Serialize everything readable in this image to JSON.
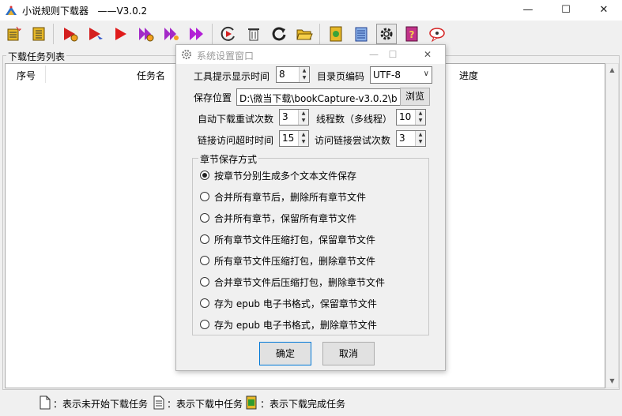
{
  "app": {
    "title": "小说规则下载器   ——V3.0.2",
    "window_controls": {
      "minimize": "—",
      "maximize": "☐",
      "close": "✕"
    }
  },
  "toolbar": {
    "buttons": [
      {
        "name": "new-task-icon"
      },
      {
        "name": "task-list-icon"
      },
      {
        "name": "start-settings-icon"
      },
      {
        "name": "start-select-icon"
      },
      {
        "name": "start-icon"
      },
      {
        "name": "start-all-settings-icon"
      },
      {
        "name": "fast-forward-settings-icon"
      },
      {
        "name": "fast-forward-icon"
      },
      {
        "name": "restart-icon"
      },
      {
        "name": "delete-icon"
      },
      {
        "name": "refresh-icon"
      },
      {
        "name": "open-folder-icon"
      },
      {
        "name": "book-icon"
      },
      {
        "name": "notebook-icon"
      },
      {
        "name": "gear-icon"
      },
      {
        "name": "help-book-icon"
      },
      {
        "name": "chat-icon"
      }
    ]
  },
  "task_panel": {
    "group_label": "下载任务列表",
    "columns": [
      "序号",
      "任务名",
      "进度"
    ]
  },
  "status_bar": {
    "items": [
      {
        "label": "：表示未开始下载任务",
        "icon": "blank-page-icon"
      },
      {
        "label": "：表示下载中任务",
        "icon": "lined-page-icon"
      },
      {
        "label": "：表示下载完成任务",
        "icon": "green-book-icon"
      }
    ]
  },
  "dialog": {
    "title": "系统设置窗口",
    "fields": {
      "tooltip_time_label": "工具提示显示时间",
      "tooltip_time_value": "8",
      "encoding_label": "目录页编码",
      "encoding_value": "UTF-8",
      "save_location_label": "保存位置",
      "save_location_value": "D:\\微当下载\\bookCapture-v3.0.2\\b",
      "browse_button": "浏览",
      "retry_label": "自动下载重试次数",
      "retry_value": "3",
      "threads_label": "线程数（多线程）",
      "threads_value": "10",
      "timeout_label": "链接访问超时时间",
      "timeout_value": "15",
      "link_retry_label": "访问链接尝试次数",
      "link_retry_value": "3"
    },
    "save_mode": {
      "group_label": "章节保存方式",
      "selected_index": 0,
      "options": [
        "按章节分别生成多个文本文件保存",
        "合并所有章节后，删除所有章节文件",
        "合并所有章节，保留所有章节文件",
        "所有章节文件压缩打包，保留章节文件",
        "所有章节文件压缩打包，删除章节文件",
        "合并章节文件后压缩打包，删除章节文件",
        "存为 epub 电子书格式，保留章节文件",
        "存为 epub 电子书格式，删除章节文件"
      ]
    },
    "ok_button": "确定",
    "cancel_button": "取消"
  }
}
